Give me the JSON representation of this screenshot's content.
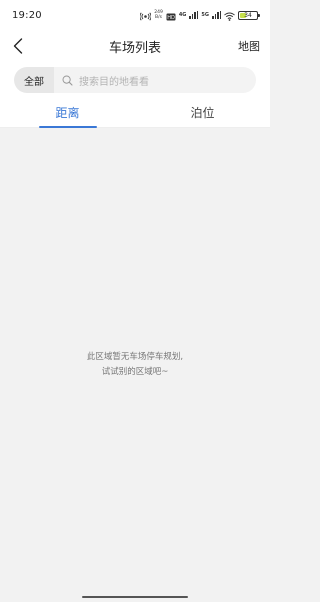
{
  "status_bar": {
    "time": "19:20",
    "net_speed_value": "249",
    "net_speed_unit": "B/s",
    "sim1_label": "4G",
    "sim2_label": "5G",
    "battery_level": "34",
    "battery_color": "#c7e04a",
    "icons": [
      "hotspot-icon",
      "hd-icon",
      "signal-icon",
      "wifi-icon",
      "battery-icon"
    ]
  },
  "nav": {
    "back_icon": "chevron-left-icon",
    "title": "车场列表",
    "right_action": "地图"
  },
  "search": {
    "filter_label": "全部",
    "icon": "search-icon",
    "placeholder": "搜索目的地看看"
  },
  "tabs": [
    {
      "label": "距离",
      "active": true
    },
    {
      "label": "泊位",
      "active": false
    }
  ],
  "empty_state": {
    "line1": "此区域暂无车场停车规划,",
    "line2": "试试别的区域吧~"
  },
  "colors": {
    "accent": "#3a78d6",
    "background": "#f2f2f2"
  }
}
